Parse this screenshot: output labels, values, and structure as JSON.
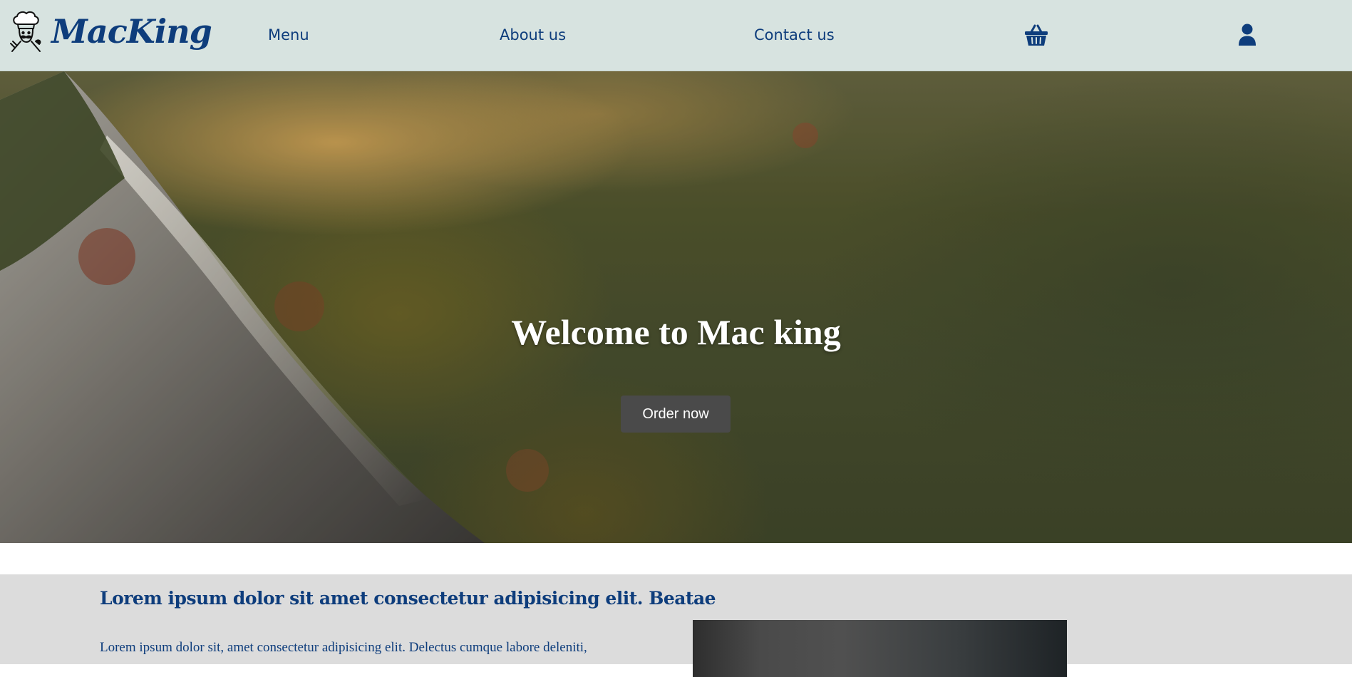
{
  "header": {
    "logo_text": "MacKing",
    "nav": [
      {
        "label": "Menu"
      },
      {
        "label": "About us"
      },
      {
        "label": "Contact us"
      }
    ],
    "icons": {
      "cart": "basket-icon",
      "user": "user-icon",
      "logo": "chef-icon"
    },
    "colors": {
      "background": "#d7e3e0",
      "accent": "#0e3d7c"
    }
  },
  "hero": {
    "title": "Welcome to Mac king",
    "button_label": "Order now"
  },
  "content": {
    "heading": "Lorem ipsum dolor sit amet consectetur adipisicing elit. Beatae",
    "paragraph": "Lorem ipsum dolor sit, amet consectetur adipisicing elit. Delectus cumque labore deleniti,"
  }
}
